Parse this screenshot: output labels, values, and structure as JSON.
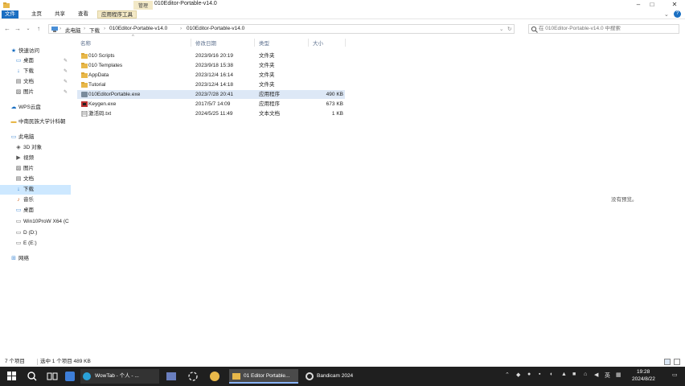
{
  "window": {
    "context_tab": "管理",
    "title": "010Editor-Portable-v14.0",
    "ribbon_tabs": [
      "文件",
      "主页",
      "共享",
      "查看",
      "应用程序工具"
    ]
  },
  "address": {
    "crumbs": [
      "此电脑",
      "下载",
      "010Editor-Portable-v14.0",
      "010Editor-Portable-v14.0"
    ],
    "search_placeholder": "在 010Editor-Portable-v14.0 中搜索"
  },
  "nav": [
    {
      "label": "快速访问",
      "icon": "star-icon",
      "indent": 0,
      "pinned": false,
      "selected": false
    },
    {
      "label": "桌面",
      "icon": "desktop-icon",
      "indent": 1,
      "pinned": true,
      "selected": false
    },
    {
      "label": "下载",
      "icon": "download-icon",
      "indent": 1,
      "pinned": true,
      "selected": false
    },
    {
      "label": "文档",
      "icon": "document-icon",
      "indent": 1,
      "pinned": true,
      "selected": false
    },
    {
      "label": "图片",
      "icon": "picture-icon",
      "indent": 1,
      "pinned": true,
      "selected": false
    },
    {
      "label": "WPS云盘",
      "icon": "cloud-icon",
      "indent": 0,
      "pinned": false,
      "selected": false
    },
    {
      "label": "中南民族大学计科朝",
      "icon": "folder-icon",
      "indent": 0,
      "pinned": false,
      "selected": false
    },
    {
      "label": "此电脑",
      "icon": "computer-icon",
      "indent": 0,
      "pinned": false,
      "selected": false
    },
    {
      "label": "3D 对象",
      "icon": "cube-icon",
      "indent": 1,
      "pinned": false,
      "selected": false
    },
    {
      "label": "视频",
      "icon": "video-icon",
      "indent": 1,
      "pinned": false,
      "selected": false
    },
    {
      "label": "图片",
      "icon": "picture-icon",
      "indent": 1,
      "pinned": false,
      "selected": false
    },
    {
      "label": "文档",
      "icon": "document-icon",
      "indent": 1,
      "pinned": false,
      "selected": false
    },
    {
      "label": "下载",
      "icon": "download-icon",
      "indent": 1,
      "pinned": false,
      "selected": true
    },
    {
      "label": "音乐",
      "icon": "music-icon",
      "indent": 1,
      "pinned": false,
      "selected": false
    },
    {
      "label": "桌面",
      "icon": "desktop-icon",
      "indent": 1,
      "pinned": false,
      "selected": false
    },
    {
      "label": "Win10ProW X64 (C",
      "icon": "drive-icon",
      "indent": 1,
      "pinned": false,
      "selected": false
    },
    {
      "label": "D (D:)",
      "icon": "drive-icon",
      "indent": 1,
      "pinned": false,
      "selected": false
    },
    {
      "label": "E (E:)",
      "icon": "drive-icon",
      "indent": 1,
      "pinned": false,
      "selected": false
    },
    {
      "label": "网络",
      "icon": "network-icon",
      "indent": 0,
      "pinned": false,
      "selected": false
    }
  ],
  "columns": [
    "名称",
    "修改日期",
    "类型",
    "大小"
  ],
  "files": [
    {
      "name": "010 Scripts",
      "date": "2023/9/16 20:19",
      "type": "文件夹",
      "size": "",
      "icon": "folder-icon",
      "selected": false
    },
    {
      "name": "010 Templates",
      "date": "2023/9/18 15:38",
      "type": "文件夹",
      "size": "",
      "icon": "folder-icon",
      "selected": false
    },
    {
      "name": "AppData",
      "date": "2023/12/4 16:14",
      "type": "文件夹",
      "size": "",
      "icon": "folder-icon",
      "selected": false
    },
    {
      "name": "Tutorial",
      "date": "2023/12/4 14:18",
      "type": "文件夹",
      "size": "",
      "icon": "folder-icon",
      "selected": false
    },
    {
      "name": "010EditorPortable.exe",
      "date": "2023/7/28 20:41",
      "type": "应用程序",
      "size": "490 KB",
      "icon": "exe-icon",
      "selected": true
    },
    {
      "name": "Keygen.exe",
      "date": "2017/5/7 14:09",
      "type": "应用程序",
      "size": "673 KB",
      "icon": "keygen-icon",
      "selected": false
    },
    {
      "name": "激活码.txt",
      "date": "2024/5/25 11:49",
      "type": "文本文档",
      "size": "1 KB",
      "icon": "text-file-icon",
      "selected": false
    }
  ],
  "empty_hint": "没有预览。",
  "status": {
    "count": "7 个项目",
    "selection": "选中 1 个项目  489 KB"
  },
  "taskbar": {
    "app1": "WowTab - 个人 - ...",
    "app2": "01  Editor Portable...",
    "app3": "Bandicam 2024",
    "ime": "英",
    "time": "19:28",
    "date": "2024/8/22"
  },
  "colors": {
    "accent": "#1a6fc2",
    "selection": "#cde8ff",
    "folder": "#e8b84a"
  }
}
